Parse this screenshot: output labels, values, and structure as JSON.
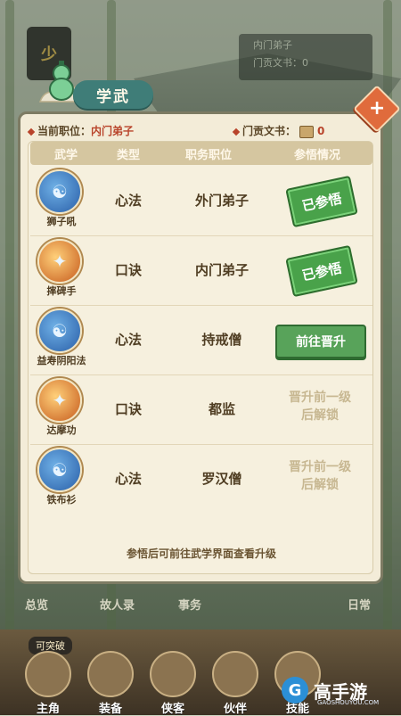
{
  "background": {
    "badge_char": "少",
    "top_info_line1": "内门弟子",
    "top_info_line2": "门贡文书：",
    "top_info_count": "0"
  },
  "dialog": {
    "title": "学武",
    "close_label": "+",
    "current_post_label": "当前职位：",
    "current_post_value": "内门弟子",
    "merit_label": "门贡文书：",
    "merit_value": "0",
    "columns": [
      "武学",
      "类型",
      "职务职位",
      "参悟情况"
    ],
    "rows": [
      {
        "name": "狮子吼",
        "type": "心法",
        "post": "外门弟子",
        "status": "已参悟",
        "status_kind": "learned",
        "icon": "book-icon"
      },
      {
        "name": "摔碑手",
        "type": "口诀",
        "post": "内门弟子",
        "status": "已参悟",
        "status_kind": "learned",
        "icon": "fire-skill-icon"
      },
      {
        "name": "益寿阴阳法",
        "type": "心法",
        "post": "持戒僧",
        "status": "前往晋升",
        "status_kind": "goto",
        "icon": "book-icon"
      },
      {
        "name": "达摩功",
        "type": "口诀",
        "post": "都监",
        "status_line1": "晋升前一级",
        "status_line2": "后解锁",
        "status_kind": "locked",
        "icon": "fire-skill-icon"
      },
      {
        "name": "铁布衫",
        "type": "心法",
        "post": "罗汉僧",
        "status_line1": "晋升前一级",
        "status_line2": "后解锁",
        "status_kind": "locked",
        "icon": "book-icon"
      }
    ],
    "footer_note": "参悟后可前往武学界面查看升级"
  },
  "bottom_nav": {
    "row1": [
      "总览",
      "故人录",
      "事务",
      "日常"
    ],
    "badge": "可突破",
    "tabs": [
      "主角",
      "装备",
      "侠客",
      "伙伴",
      "技能"
    ]
  },
  "watermark": {
    "glyph": "G",
    "title": "高手游",
    "sub": "GAOSHOUYOU.COM"
  }
}
